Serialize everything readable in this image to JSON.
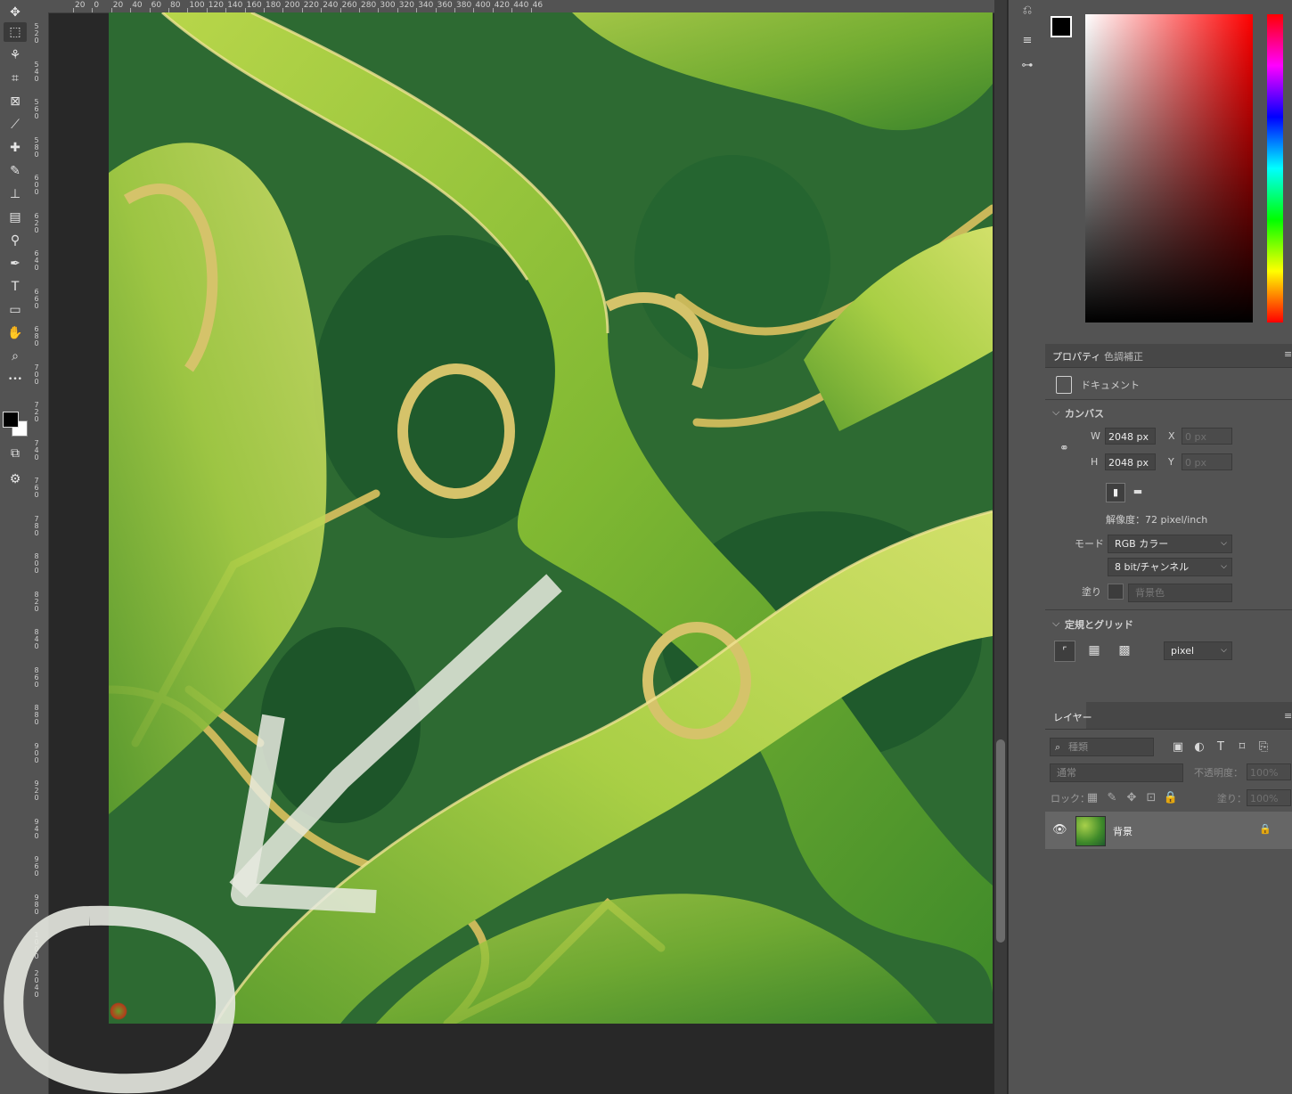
{
  "rulers": {
    "top_labels": [
      "20",
      "0",
      "20",
      "40",
      "60",
      "80",
      "100",
      "120",
      "140",
      "160",
      "180",
      "200",
      "220",
      "240",
      "260",
      "280",
      "300",
      "320",
      "340",
      "360",
      "380",
      "400",
      "420",
      "440",
      "46"
    ],
    "left_labels": [
      "520",
      "540",
      "560",
      "580",
      "600",
      "620",
      "640",
      "660",
      "680",
      "700",
      "720",
      "740",
      "760",
      "780",
      "800",
      "820",
      "840",
      "860",
      "880",
      "900",
      "920",
      "940",
      "960",
      "980",
      "1000",
      "2040"
    ]
  },
  "toolbar": {
    "tools": [
      {
        "icon": "move-icon",
        "glyph": "✥"
      },
      {
        "icon": "marquee-icon",
        "glyph": "⬚"
      },
      {
        "icon": "quick-select-icon",
        "glyph": "⚘"
      },
      {
        "icon": "crop-icon",
        "glyph": "⌗"
      },
      {
        "icon": "frame-icon",
        "glyph": "⊠"
      },
      {
        "icon": "eyedropper-icon",
        "glyph": "⟋"
      },
      {
        "icon": "healing-brush-icon",
        "glyph": "✚"
      },
      {
        "icon": "brush-icon",
        "glyph": "✎"
      },
      {
        "icon": "clone-stamp-icon",
        "glyph": "⊥"
      },
      {
        "icon": "gradient-icon",
        "glyph": "▤"
      },
      {
        "icon": "dodge-icon",
        "glyph": "⚲"
      },
      {
        "icon": "pen-icon",
        "glyph": "✒"
      },
      {
        "icon": "type-icon",
        "glyph": "T"
      },
      {
        "icon": "rectangle-icon",
        "glyph": "▭"
      },
      {
        "icon": "hand-icon",
        "glyph": "✋"
      },
      {
        "icon": "zoom-icon",
        "glyph": "⌕"
      },
      {
        "icon": "more-tools-icon",
        "glyph": "•••"
      }
    ],
    "foreground_color": "#000000",
    "background_color": "#ffffff"
  },
  "color_picker": {
    "hue_color": "#ff0000"
  },
  "properties": {
    "tabs": [
      "プロパティ",
      "色調補正"
    ],
    "doc_label": "ドキュメント",
    "canvas_section": "カンバス",
    "w_label": "W",
    "w_value": "2048 px",
    "h_label": "H",
    "h_value": "2048 px",
    "x_label": "X",
    "x_value": "0 px",
    "y_label": "Y",
    "y_value": "0 px",
    "resolution": "解像度：72 pixel/inch",
    "mode_label": "モード",
    "mode_value": "RGB カラー",
    "bit_value": "8 bit/チャンネル",
    "fill_label": "塗り",
    "fill_value": "背景色",
    "grid_section": "定規とグリッド",
    "unit_value": "pixel"
  },
  "layers": {
    "tab": "レイヤー",
    "search_placeholder": "種類",
    "blend_mode": "通常",
    "opacity_label": "不透明度：",
    "opacity_value": "100%",
    "lock_label": "ロック：",
    "fill_label": "塗り：",
    "fill_value": "100%",
    "items": [
      {
        "name": "背景",
        "locked": true,
        "visible": true
      }
    ]
  }
}
